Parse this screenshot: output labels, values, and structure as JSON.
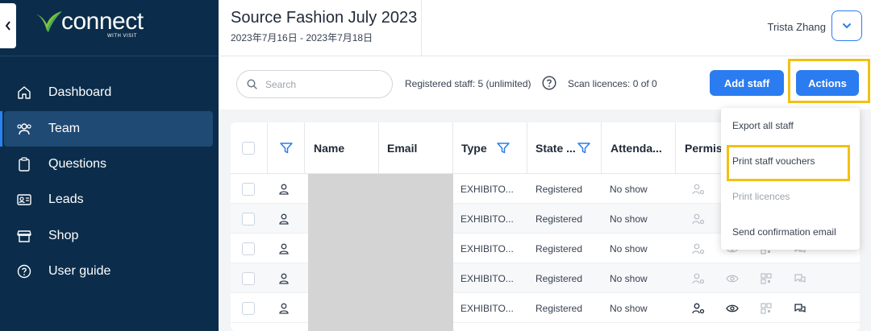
{
  "brand": {
    "logo_text": "connect",
    "logo_sub": "WITH VISIT",
    "accent": "#2b7cf0",
    "highlight": "#f2c012"
  },
  "sidebar": {
    "collapse_icon": "chevron-left-icon",
    "items": [
      {
        "label": "Dashboard",
        "icon": "home-icon"
      },
      {
        "label": "Team",
        "icon": "team-icon",
        "active": true
      },
      {
        "label": "Questions",
        "icon": "clipboard-icon"
      },
      {
        "label": "Leads",
        "icon": "id-card-icon"
      },
      {
        "label": "Shop",
        "icon": "shop-icon"
      },
      {
        "label": "User guide",
        "icon": "help-circle-icon"
      }
    ]
  },
  "header": {
    "title": "Source Fashion July 2023",
    "dates": "2023年7月16日 - 2023年7月18日",
    "user_name": "Trista Zhang"
  },
  "toolbar": {
    "search_placeholder": "Search",
    "registered_staff": "Registered staff: 5 (unlimited)",
    "scan_licences": "Scan licences: 0 of 0",
    "add_staff_label": "Add staff",
    "actions_label": "Actions"
  },
  "table": {
    "columns": [
      "Name",
      "Email",
      "Type",
      "State ...",
      "Attenda...",
      "Permis"
    ],
    "rows": [
      {
        "type": "EXHIBITO...",
        "state": "Registered",
        "attendance": "No show"
      },
      {
        "type": "EXHIBITO...",
        "state": "Registered",
        "attendance": "No show"
      },
      {
        "type": "EXHIBITO...",
        "state": "Registered",
        "attendance": "No show"
      },
      {
        "type": "EXHIBITO...",
        "state": "Registered",
        "attendance": "No show"
      },
      {
        "type": "EXHIBITO...",
        "state": "Registered",
        "attendance": "No show"
      }
    ]
  },
  "actions_menu": {
    "items": [
      {
        "label": "Export all staff",
        "enabled": true
      },
      {
        "label": "Print staff vouchers",
        "enabled": true
      },
      {
        "label": "Print licences",
        "enabled": false
      },
      {
        "label": "Send confirmation email",
        "enabled": true
      }
    ]
  }
}
